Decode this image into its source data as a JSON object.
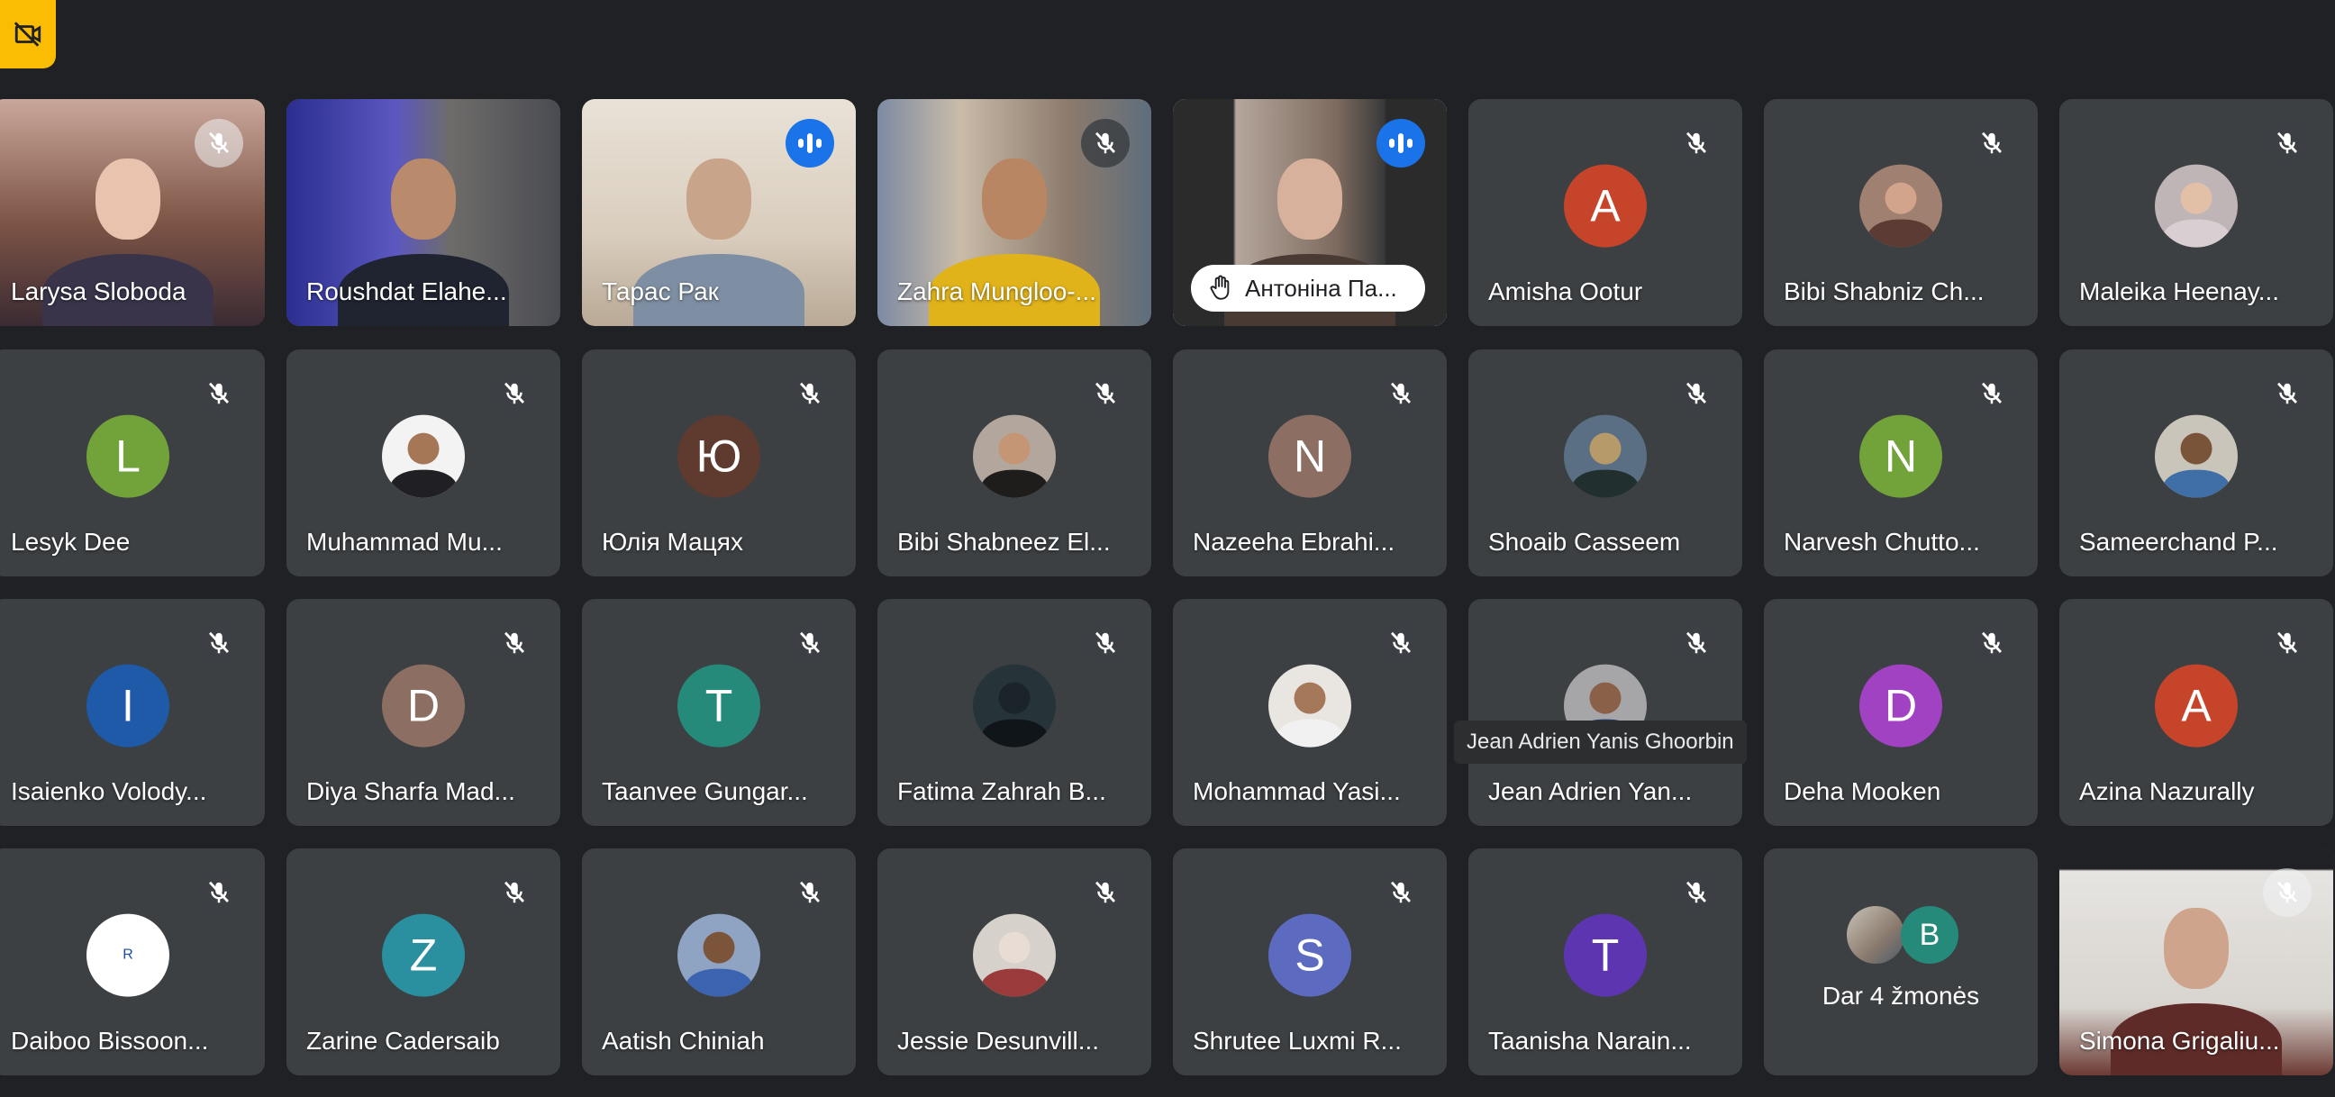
{
  "tooltip": "Jean Adrien Yanis Ghoorbin",
  "colors": {
    "background": "#202124",
    "tile": "#3c4043",
    "active_border": "#8ab4f8",
    "speaking": "#1a73e8",
    "badge": "#fbbc04"
  },
  "tiles": [
    {
      "name": "Larysa Sloboda",
      "kind": "video",
      "mic": "muted-light",
      "bg": "linear-gradient(180deg,#c9a79a 0%,#7d5446 55%,#3b2b33 100%)",
      "face": "#e9c3ae",
      "body": "#39344a"
    },
    {
      "name": "Roushdat Elahe...",
      "kind": "video",
      "mic": "none",
      "bg": "linear-gradient(90deg,#2b2e8f 0%,#5c58c0 40%,#6e6c6a 60%,#4a4b52 100%)",
      "face": "#b98a6c",
      "body": "#1f2430"
    },
    {
      "name": "Тарас Рак",
      "kind": "video",
      "mic": "speaking",
      "bg": "linear-gradient(180deg,#e9e2d7 0%,#d9cdbd 60%,#b9a996 100%)",
      "face": "#c8a48a",
      "body": "#7f8fa3"
    },
    {
      "name": "Zahra Mungloo-...",
      "kind": "video",
      "mic": "muted",
      "bg": "linear-gradient(90deg,#7d8aa3 0%,#c9bca8 30%,#8c7a6c 70%,#5e6e7d 100%)",
      "face": "#b98663",
      "body": "#e0b31a"
    },
    {
      "name": "Антоніна Па...",
      "kind": "video-hand",
      "mic": "speaking",
      "bg": "linear-gradient(90deg,#2b2b2b 0%,#2b2b2b 22%,#b5a79c 23%,#7d6a5e 60%,#3a3a3a 77%,#2b2b2b 78%)",
      "face": "#d7b19b",
      "body": "#4a3a34"
    },
    {
      "name": "Amisha Ootur",
      "kind": "avatar",
      "letter": "A",
      "color": "#c5442a",
      "mic": "muted"
    },
    {
      "name": "Bibi Shabniz Ch...",
      "kind": "photo",
      "face": "#d2a48b",
      "body": "#5b3b33",
      "abg": "#a08070",
      "mic": "muted"
    },
    {
      "name": "Maleika Heenay...",
      "kind": "photo",
      "face": "#e2c0a8",
      "body": "#d9cfd2",
      "abg": "#bfb5b6",
      "mic": "muted"
    },
    {
      "name": "Lesyk Dee",
      "kind": "avatar",
      "letter": "L",
      "color": "#71a33a",
      "mic": "muted"
    },
    {
      "name": "Muhammad Mu...",
      "kind": "photo",
      "face": "#a57756",
      "body": "#1f1f24",
      "abg": "#f3f3f3",
      "mic": "muted"
    },
    {
      "name": "Юлія Мацях",
      "kind": "avatar",
      "letter": "Ю",
      "color": "#5e3b2e",
      "mic": "muted"
    },
    {
      "name": "Bibi Shabneez El...",
      "kind": "photo",
      "face": "#c59676",
      "body": "#1f1c1c",
      "abg": "#b3a79d",
      "mic": "muted"
    },
    {
      "name": "Nazeeha Ebrahi...",
      "kind": "avatar",
      "letter": "N",
      "color": "#8d6e63",
      "mic": "muted"
    },
    {
      "name": "Shoaib Casseem",
      "kind": "photo",
      "face": "#b79a6a",
      "body": "#21302f",
      "abg": "#5a6f84",
      "mic": "muted"
    },
    {
      "name": "Narvesh Chutto...",
      "kind": "avatar",
      "letter": "N",
      "color": "#71a33a",
      "mic": "muted"
    },
    {
      "name": "Sameerchand P...",
      "kind": "photo",
      "face": "#7a5439",
      "body": "#3f6fa6",
      "abg": "#c9c5bb",
      "mic": "muted"
    },
    {
      "name": "Isaienko Volody...",
      "kind": "avatar",
      "letter": "I",
      "color": "#1e5aa8",
      "mic": "muted"
    },
    {
      "name": "Diya Sharfa Mad...",
      "kind": "avatar",
      "letter": "D",
      "color": "#8d6e63",
      "mic": "muted"
    },
    {
      "name": "Taanvee Gungar...",
      "kind": "avatar",
      "letter": "T",
      "color": "#268a7a",
      "mic": "muted"
    },
    {
      "name": "Fatima Zahrah B...",
      "kind": "photo",
      "face": "#1a2428",
      "body": "#0f1518",
      "abg": "#26343a",
      "mic": "muted"
    },
    {
      "name": "Mohammad Yasi...",
      "kind": "photo",
      "face": "#a5785a",
      "body": "#f1f1f1",
      "abg": "#e9e6e1",
      "mic": "muted"
    },
    {
      "name": "Jean Adrien Yan...",
      "kind": "photo",
      "face": "#8a6048",
      "body": "#2b3a63",
      "abg": "#a6a6a9",
      "mic": "muted"
    },
    {
      "name": "Deha Mooken",
      "kind": "avatar",
      "letter": "D",
      "color": "#a142c3",
      "mic": "muted"
    },
    {
      "name": "Azina Nazurally",
      "kind": "avatar",
      "letter": "A",
      "color": "#c5442a",
      "mic": "muted"
    },
    {
      "name": "Daiboo Bissoon...",
      "kind": "avatar",
      "letter": "R",
      "color": "#ffffff",
      "letterColor": "#1e4aa8",
      "small": true,
      "mic": "muted"
    },
    {
      "name": "Zarine Cadersaib",
      "kind": "avatar",
      "letter": "Z",
      "color": "#2a8f9e",
      "mic": "muted"
    },
    {
      "name": "Aatish Chiniah",
      "kind": "photo",
      "face": "#7c5439",
      "body": "#3b63b0",
      "abg": "#8fa3c3",
      "mic": "muted"
    },
    {
      "name": "Jessie Desunvill...",
      "kind": "photo",
      "face": "#e8dcd5",
      "body": "#9a3a3a",
      "abg": "#d7d1cb",
      "mic": "muted"
    },
    {
      "name": "Shrutee Luxmi R...",
      "kind": "avatar",
      "letter": "S",
      "color": "#5c6bc0",
      "mic": "muted"
    },
    {
      "name": "Taanisha Narain...",
      "kind": "avatar",
      "letter": "T",
      "color": "#5e35b1",
      "mic": "muted"
    },
    {
      "name": "",
      "kind": "group",
      "group_label": "Dar 4 žmonės",
      "group_letter": "B",
      "mic": "none"
    },
    {
      "name": "Simona Grigaliu...",
      "kind": "video",
      "mic": "muted-light",
      "bg": "linear-gradient(180deg,#202124 0%,#202124 9%,#e6e4e1 10%,#d8d4cf 70%,#6b3a33 100%)",
      "face": "#cfa48c",
      "body": "#5e2b28"
    }
  ]
}
